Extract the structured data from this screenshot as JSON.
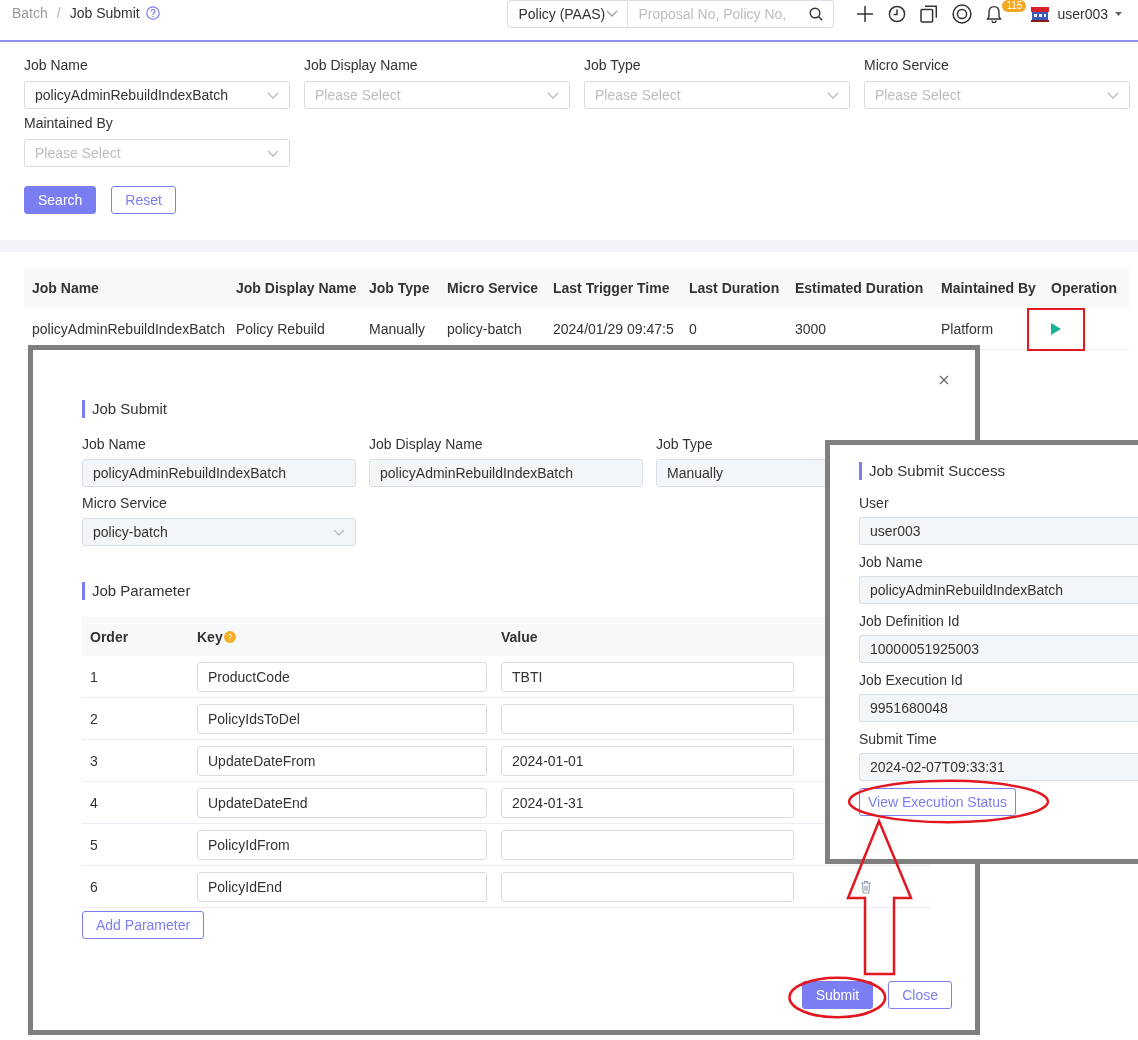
{
  "breadcrumb": {
    "items": [
      {
        "label": "Batch",
        "current": false
      },
      {
        "label": "Job Submit",
        "current": true
      }
    ],
    "separator": "/"
  },
  "header": {
    "scope_select": {
      "value": "Policy (PAAS)"
    },
    "search": {
      "placeholder": "Proposal No, Policy No,"
    },
    "notification_badge": "115",
    "user": "user003"
  },
  "filters": {
    "fields": [
      {
        "label": "Job Name",
        "value": "policyAdminRebuildIndexBatch"
      },
      {
        "label": "Job Display Name",
        "placeholder": "Please Select"
      },
      {
        "label": "Job Type",
        "placeholder": "Please Select"
      },
      {
        "label": "Micro Service",
        "placeholder": "Please Select"
      },
      {
        "label": "Maintained By",
        "placeholder": "Please Select"
      }
    ],
    "buttons": [
      {
        "label": "Search",
        "kind": "primary"
      },
      {
        "label": "Reset",
        "kind": "outline"
      }
    ]
  },
  "table": {
    "columns": [
      "Job Name",
      "Job Display Name",
      "Job Type",
      "Micro Service",
      "Last Trigger Time",
      "Last Duration",
      "Estimated Duration",
      "Maintained By",
      "Operation"
    ],
    "rows": [
      {
        "cells": [
          "policyAdminRebuildIndexBatch",
          "Policy Rebuild",
          "Manually",
          "policy-batch",
          "2024/01/29 09:47:5",
          "0",
          "3000",
          "Platform"
        ],
        "operation": {
          "highlighted": true
        }
      }
    ]
  },
  "job_submit_dialog": {
    "title": "Job Submit",
    "fields": [
      {
        "label": "Job Name",
        "value": "policyAdminRebuildIndexBatch",
        "kind": "text"
      },
      {
        "label": "Job Display Name",
        "value": "policyAdminRebuildIndexBatch",
        "kind": "text"
      },
      {
        "label": "Job Type",
        "value": "Manually",
        "kind": "text"
      },
      {
        "label": "Micro Service",
        "value": "policy-batch",
        "kind": "select"
      }
    ],
    "parameters": {
      "title": "Job Parameter",
      "columns": [
        {
          "label": "Order",
          "help": false
        },
        {
          "label": "Key",
          "help": true
        },
        {
          "label": "Value",
          "help": false
        }
      ],
      "rows": [
        {
          "order": "1",
          "key": "ProductCode",
          "value": "TBTI",
          "removable": false
        },
        {
          "order": "2",
          "key": "PolicyIdsToDel",
          "removable": false
        },
        {
          "order": "3",
          "key": "UpdateDateFrom",
          "value": "2024-01-01",
          "removable": false
        },
        {
          "order": "4",
          "key": "UpdateDateEnd",
          "value": "2024-01-31",
          "removable": false
        },
        {
          "order": "5",
          "key": "PolicyIdFrom",
          "removable": false
        },
        {
          "order": "6",
          "key": "PolicyIdEnd",
          "removable": true
        }
      ],
      "add_button": "Add Parameter"
    },
    "buttons": [
      {
        "label": "Submit",
        "kind": "primary",
        "highlighted": true
      },
      {
        "label": "Close",
        "kind": "outline",
        "highlighted": false
      }
    ]
  },
  "success_dialog": {
    "title": "Job Submit Success",
    "fields": [
      {
        "label": "User",
        "value": "user003"
      },
      {
        "label": "Job Name",
        "value": "policyAdminRebuildIndexBatch"
      },
      {
        "label": "Job Definition Id",
        "value": "10000051925003"
      },
      {
        "label": "Job Execution Id",
        "value": "9951680048"
      },
      {
        "label": "Submit Time",
        "value": "2024-02-07T09:33:31"
      }
    ],
    "button": {
      "label": "View Execution Status",
      "highlighted": true
    }
  }
}
